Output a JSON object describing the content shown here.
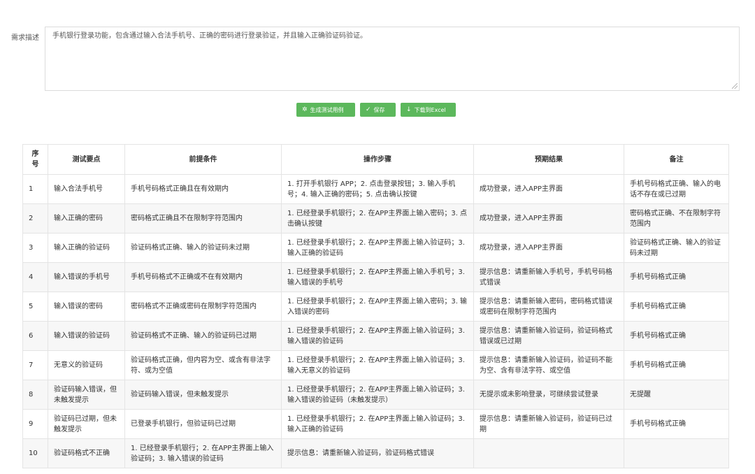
{
  "requirement": {
    "label": "需求描述",
    "text": "手机银行登录功能，包含通过输入合法手机号、正确的密码进行登录验证，并且输入正确验证码验证。"
  },
  "buttons": {
    "generate": "生成测试用例",
    "save": "保存",
    "download": "下载到Excel"
  },
  "table": {
    "headers": [
      "序号",
      "测试要点",
      "前提条件",
      "操作步骤",
      "预期结果",
      "备注"
    ],
    "rows": [
      [
        "1",
        "输入合法手机号",
        "手机号码格式正确且在有效期内",
        "1. 打开手机银行 APP；2. 点击登录按钮；3. 输入手机号；4. 输入正确的密码；5. 点击确认按键",
        "成功登录，进入APP主界面",
        "手机号码格式正确、输入的电话不存在或已过期"
      ],
      [
        "2",
        "输入正确的密码",
        "密码格式正确且不在限制字符范围内",
        "1. 已经登录手机银行；2. 在APP主界面上输入密码；3. 点击确认按键",
        "成功登录，进入APP主界面",
        "密码格式正确、不在限制字符范围内"
      ],
      [
        "3",
        "输入正确的验证码",
        "验证码格式正确、输入的验证码未过期",
        "1. 已经登录手机银行；2. 在APP主界面上输入验证码；3. 输入正确的验证码",
        "成功登录，进入APP主界面",
        "验证码格式正确、输入的验证码未过期"
      ],
      [
        "4",
        "输入错误的手机号",
        "手机号码格式不正确或不在有效期内",
        "1. 已经登录手机银行；2. 在APP主界面上输入手机号；3. 输入错误的手机号",
        "提示信息：请重新输入手机号，手机号码格式错误",
        "手机号码格式正确"
      ],
      [
        "5",
        "输入错误的密码",
        "密码格式不正确或密码在限制字符范围内",
        "1. 已经登录手机银行；2. 在APP主界面上输入密码；3. 输入错误的密码",
        "提示信息：请重新输入密码，密码格式错误或密码在限制字符范围内",
        "手机号码格式正确"
      ],
      [
        "6",
        "输入错误的验证码",
        "验证码格式不正确、输入的验证码已过期",
        "1. 已经登录手机银行；2. 在APP主界面上输入验证码；3. 输入错误的验证码",
        "提示信息：请重新输入验证码，验证码格式错误或已过期",
        "手机号码格式正确"
      ],
      [
        "7",
        "无意义的验证码",
        "验证码格式正确，但内容为空、或含有非法字符、或为空值",
        "1. 已经登录手机银行；2. 在APP主界面上输入验证码；3. 输入无意义的验证码",
        "提示信息：请重新输入验证码，验证码不能为空、含有非法字符、或空值",
        "手机号码格式正确"
      ],
      [
        "8",
        "验证码输入错误，但未触发提示",
        "验证码输入错误，但未触发提示",
        "1. 已经登录手机银行；2. 在APP主界面上输入验证码；3. 输入错误的验证码（未触发提示）",
        "无提示或未影响登录，可继续尝试登录",
        "无提醒"
      ],
      [
        "9",
        "验证码已过期，但未触发提示",
        "已登录手机银行，但验证码已过期",
        "1. 已经登录手机银行；2. 在APP主界面上输入验证码；3. 输入正确的验证码",
        "提示信息：请重新输入验证码，验证码已过期",
        "手机号码格式正确"
      ],
      [
        "10",
        "验证码格式不正确",
        "1. 已经登录手机银行；2. 在APP主界面上输入验证码；3. 输入错误的验证码",
        "提示信息：请重新输入验证码，验证码格式错误",
        "",
        ""
      ]
    ]
  }
}
